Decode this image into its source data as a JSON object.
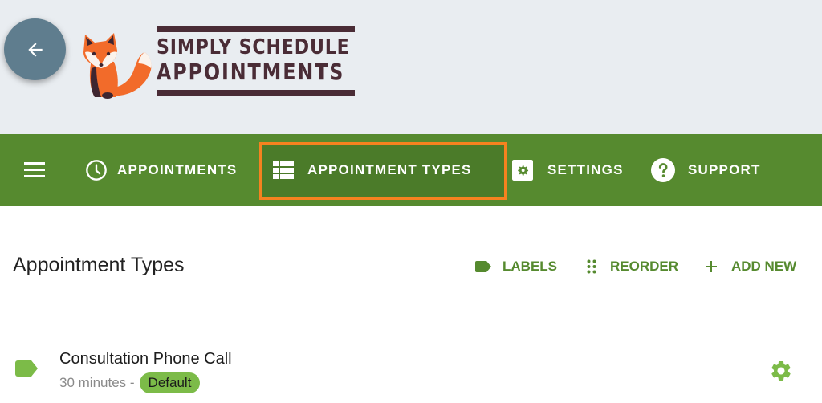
{
  "header": {
    "back_button_icon": "arrow-left-icon",
    "logo": {
      "line1": "SIMPLY SCHEDULE",
      "line2": "APPOINTMENTS",
      "mascot_icon": "fox-icon",
      "text_color": "#4a2c36"
    }
  },
  "nav": {
    "background": "#568a2f",
    "menu_icon": "hamburger-menu-icon",
    "items": [
      {
        "label": "APPOINTMENTS",
        "icon": "clock-icon"
      },
      {
        "label": "APPOINTMENT TYPES",
        "icon": "list-icon",
        "active": true
      },
      {
        "label": "SETTINGS",
        "icon": "gear-box-icon"
      },
      {
        "label": "SUPPORT",
        "icon": "help-circle-icon"
      }
    ],
    "highlight_color": "#f5821f"
  },
  "main": {
    "title": "Appointment Types",
    "actions": [
      {
        "label": "LABELS",
        "icon": "label-tag-icon"
      },
      {
        "label": "REORDER",
        "icon": "drag-dots-icon"
      },
      {
        "label": "ADD NEW",
        "icon": "plus-icon"
      }
    ],
    "accent_color": "#568a2f",
    "appointment_types": [
      {
        "title": "Consultation Phone Call",
        "duration": "30 minutes -",
        "badge": "Default",
        "label_color": "#7cbb48",
        "settings_icon": "gear-icon"
      }
    ]
  }
}
